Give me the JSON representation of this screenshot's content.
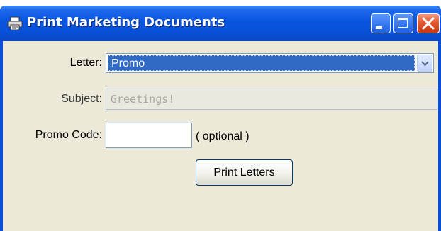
{
  "window": {
    "title": "Print Marketing Documents",
    "title_icon": "printer-icon",
    "controls": {
      "minimize_icon": "minimize-icon",
      "maximize_icon": "maximize-icon",
      "close_icon": "close-icon",
      "close_color": "#e5592f"
    },
    "titlebar_color": "#0a55e0"
  },
  "form": {
    "letter": {
      "label": "Letter:",
      "selected": "Promo",
      "selection_color": "#316ac5",
      "arrow_icon": "chevron-down-icon"
    },
    "subject": {
      "label": "Subject:",
      "value": "Greetings!"
    },
    "promo_code": {
      "label": "Promo Code:",
      "value": "",
      "hint": "( optional )"
    },
    "print_button": {
      "label": "Print Letters"
    }
  },
  "background_color": "#ece9d8"
}
